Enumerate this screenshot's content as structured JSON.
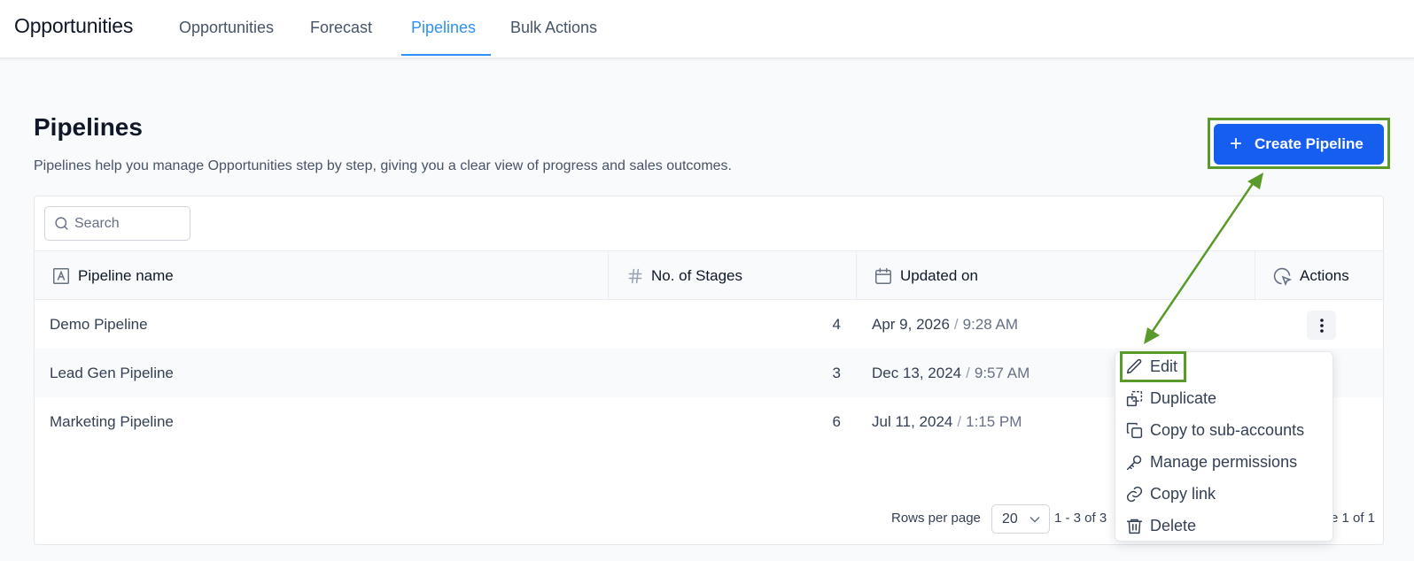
{
  "nav": {
    "app_title": "Opportunities",
    "tabs": [
      {
        "label": "Opportunities",
        "active": false
      },
      {
        "label": "Forecast",
        "active": false
      },
      {
        "label": "Pipelines",
        "active": true
      },
      {
        "label": "Bulk Actions",
        "active": false
      }
    ]
  },
  "header": {
    "title": "Pipelines",
    "description": "Pipelines help you manage Opportunities step by step, giving you a clear view of progress and sales outcomes.",
    "create_label": "Create Pipeline"
  },
  "search": {
    "placeholder": "Search",
    "value": ""
  },
  "table": {
    "columns": [
      "Pipeline name",
      "No. of Stages",
      "Updated on",
      "Actions"
    ],
    "rows": [
      {
        "name": "Demo Pipeline",
        "stages": "4",
        "date": "Apr 9, 2026",
        "time": "9:28 AM"
      },
      {
        "name": "Lead Gen Pipeline",
        "stages": "3",
        "date": "Dec 13, 2024",
        "time": "9:57 AM"
      },
      {
        "name": "Marketing Pipeline",
        "stages": "6",
        "date": "Jul 11, 2024",
        "time": "1:15 PM"
      }
    ]
  },
  "footer": {
    "rows_per_page_label": "Rows per page",
    "rows_per_page_value": "20",
    "range": "1 - 3 of 3",
    "page_of": "e 1 of 1"
  },
  "actions_menu": {
    "items": [
      {
        "label": "Edit",
        "icon": "pencil-icon"
      },
      {
        "label": "Duplicate",
        "icon": "duplicate-icon"
      },
      {
        "label": "Copy to sub-accounts",
        "icon": "copy-icon"
      },
      {
        "label": "Manage permissions",
        "icon": "key-icon"
      },
      {
        "label": "Copy link",
        "icon": "link-icon"
      },
      {
        "label": "Delete",
        "icon": "trash-icon"
      }
    ]
  },
  "colors": {
    "primary": "#155eef",
    "active_tab": "#2e90fa",
    "annotation": "#5a9a2a"
  }
}
